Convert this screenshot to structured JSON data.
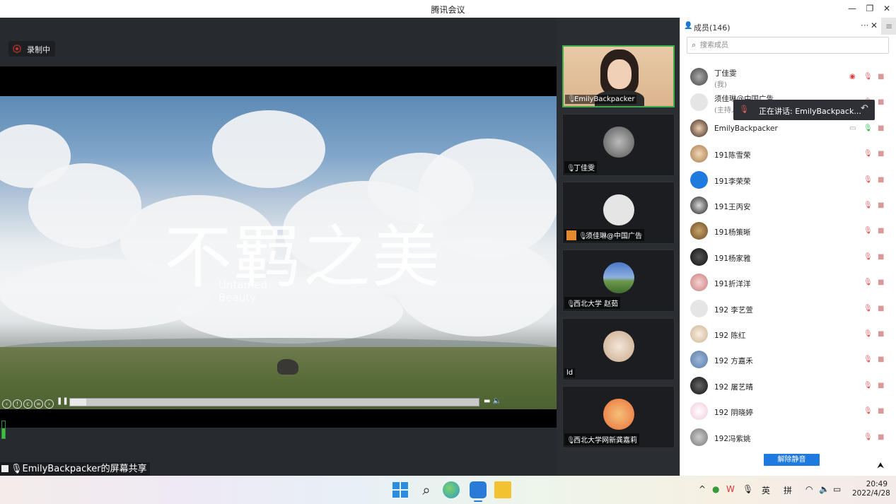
{
  "window": {
    "title": "腾讯会议"
  },
  "main": {
    "recording_label": "录制中",
    "video": {
      "title_text": "不羁之美",
      "subtitle_line1": "Untamed",
      "subtitle_line2": "Beauty",
      "progress_fraction": 0.04
    },
    "share_label": "EmilyBackpacker的屏幕共享",
    "audio_level_fraction": 0.6
  },
  "thumbnails": [
    {
      "name": "EmilyBackpacker",
      "active": true,
      "mic": "on"
    },
    {
      "name": "丁佳雯",
      "mic": "off"
    },
    {
      "name": "须佳琳@中国广告",
      "host": true,
      "mic": "off"
    },
    {
      "name": "西北大学 赵茹",
      "mic": "off"
    },
    {
      "name": "ld"
    },
    {
      "name": "西北大学网新龚嘉莉",
      "mic": "off"
    }
  ],
  "sidebar": {
    "title": "成员(146)",
    "more_icon": "ellipsis-icon",
    "search_placeholder": "搜索成员",
    "members": [
      {
        "name": "丁佳雯",
        "sub": "(我)",
        "recording": true,
        "mic": "off",
        "cam": "off"
      },
      {
        "name": "须佳琳@中国广告",
        "sub": "(主持人)",
        "mic": "off",
        "cam": "off"
      },
      {
        "name": "EmilyBackpacker",
        "mic": "on",
        "cam": "off",
        "screen_share": true
      },
      {
        "name": "191陈雪荣",
        "mic": "off",
        "cam": "off"
      },
      {
        "name": "191李荣荣",
        "mic": "off",
        "cam": "off"
      },
      {
        "name": "191王丙安",
        "mic": "off",
        "cam": "off"
      },
      {
        "name": "191杨策晰",
        "mic": "off",
        "cam": "off"
      },
      {
        "name": "191杨家雅",
        "mic": "off",
        "cam": "off"
      },
      {
        "name": "191折洋洋",
        "mic": "off",
        "cam": "off"
      },
      {
        "name": "192  李艺萱",
        "mic": "off",
        "cam": "off"
      },
      {
        "name": "192 陈红",
        "mic": "off",
        "cam": "off"
      },
      {
        "name": "192 方嘉禾",
        "mic": "off",
        "cam": "off"
      },
      {
        "name": "192 屠艺晴",
        "mic": "off",
        "cam": "off"
      },
      {
        "name": "192 阴晓婷",
        "mic": "off",
        "cam": "off"
      },
      {
        "name": "192冯紫姚",
        "mic": "off",
        "cam": "off"
      }
    ],
    "speaking_tooltip": "正在讲话: EmilyBackpack...",
    "unmute_label": "解除静音"
  },
  "taskbar": {
    "ime_1": "英",
    "ime_2": "拼",
    "time": "20:49",
    "date": "2022/4/28"
  },
  "colors": {
    "accent_blue": "#1f7ae0",
    "active_green": "#3fae4a",
    "mic_off_red": "#e35a5a",
    "host_orange": "#e58a2e"
  }
}
